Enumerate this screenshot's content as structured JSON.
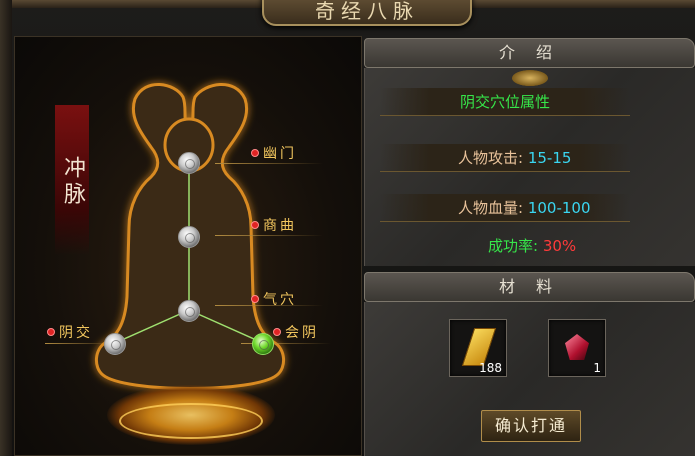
{
  "window": {
    "title": "奇经八脉"
  },
  "meridian": {
    "name": "冲脉",
    "points": [
      {
        "label": "幽门",
        "state": "inactive"
      },
      {
        "label": "商曲",
        "state": "inactive"
      },
      {
        "label": "气穴",
        "state": "inactive"
      },
      {
        "label": "阴交",
        "state": "inactive"
      },
      {
        "label": "会阴",
        "state": "active"
      }
    ]
  },
  "intro": {
    "header": "介 绍",
    "title": "阴交穴位属性",
    "attack_label": "人物攻击:",
    "attack_value": "15-15",
    "hp_label": "人物血量:",
    "hp_value": "100-100",
    "rate_label": "成功率:",
    "rate_value": "30%"
  },
  "materials": {
    "header": "材 料",
    "items": [
      {
        "icon": "scroll-icon",
        "count": "188"
      },
      {
        "icon": "red-gem-icon",
        "count": "1"
      }
    ]
  },
  "confirm_label": "确认打通",
  "colors": {
    "attr_value": "#3ad6f0",
    "rate_value": "#ff3a3a",
    "title_green": "#36e64a",
    "label_gold": "#f2c65e"
  }
}
